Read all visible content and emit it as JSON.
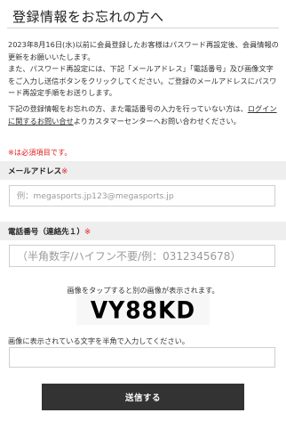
{
  "page": {
    "title": "登録情報をお忘れの方へ",
    "intro_1": "2023年8月16日(水)以前に会員登録したお客様はパスワード再設定後、会員情報の更新をお願いいたします。\nまた、パスワード再設定には、下記「メールアドレス」「電話番号」及び画像文字をご入力し送信ボタンをクリックしてください。ご登録のメールアドレスにパスワード再設定手順をお送りします。",
    "intro_2_before": "下記の登録情報をお忘れの方、また電話番号の入力を行っていない方は、",
    "intro_2_link": "ログインに関するお問い合せ",
    "intro_2_after": "よりカスタマーセンターへお問い合わせください。",
    "required_note": "※は必須項目です。"
  },
  "email": {
    "label": "メールアドレス",
    "required_mark": "※",
    "placeholder": "例：megasports.jp123@megasports.jp"
  },
  "phone": {
    "label": "電話番号（連絡先１）",
    "required_mark": "※",
    "placeholder": "（半角数字/ハイフン不要/例：0312345678）"
  },
  "captcha": {
    "caption": "画像をタップすると別の画像が表示されます。",
    "image_text": "VY88KD",
    "instruction": "画像に表示されている文字を半角で入力してください。",
    "value": ""
  },
  "submit": {
    "label": "送信する"
  }
}
